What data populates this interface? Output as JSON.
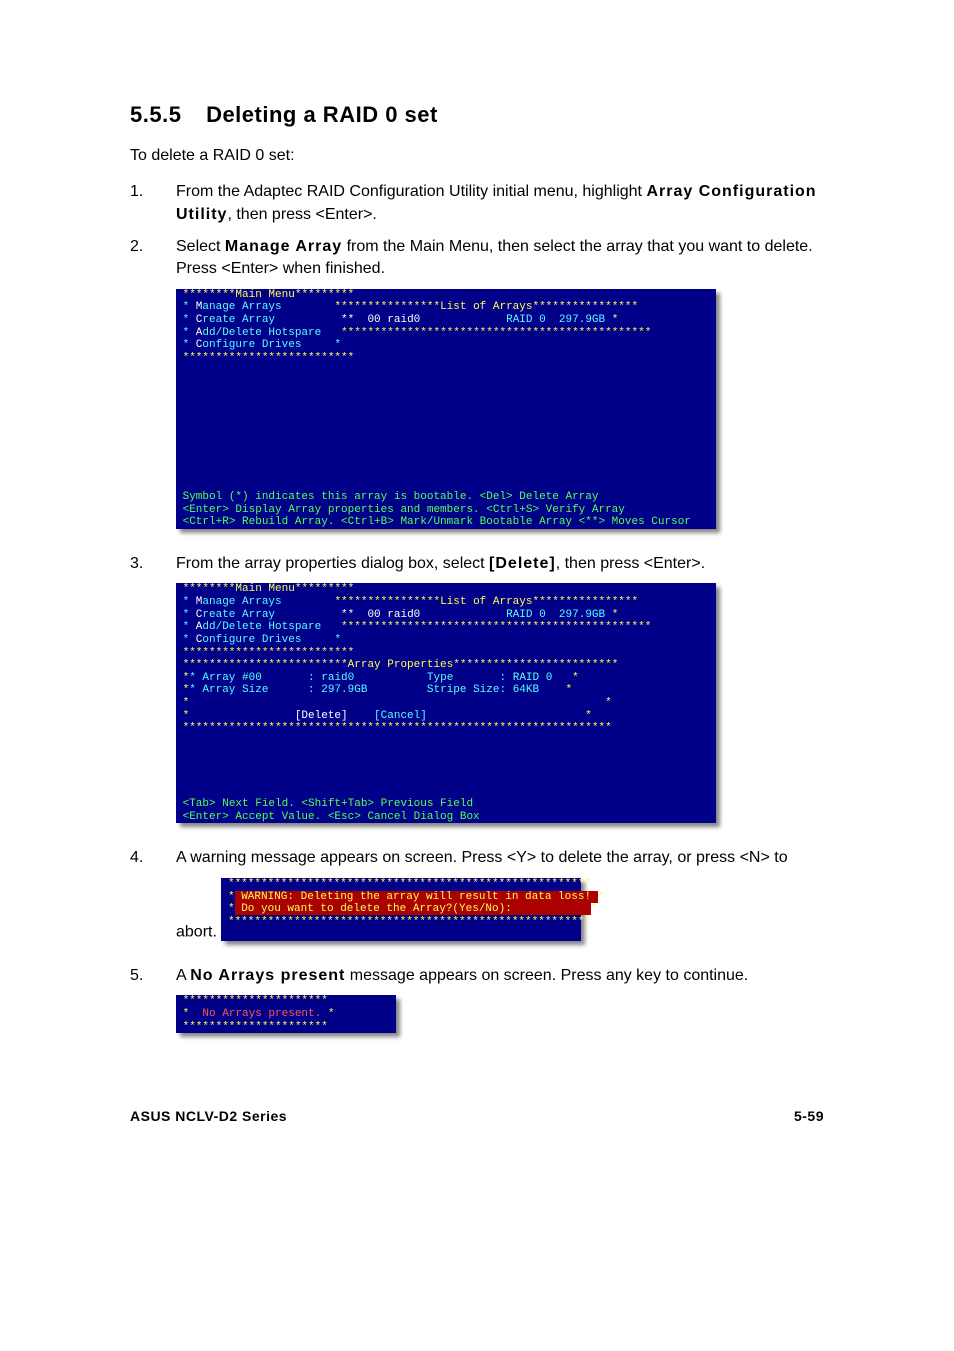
{
  "heading": {
    "number": "5.5.5",
    "title": "Deleting a RAID 0 set"
  },
  "intro": "To delete a RAID 0 set:",
  "steps": {
    "s1a": "From the Adaptec RAID Configuration Utility initial menu, highlight ",
    "s1b": "Array Configuration Utility",
    "s1c": ", then press <Enter>.",
    "s2a": "Select ",
    "s2b": "Manage Array",
    "s2c": " from the Main Menu, then select the array that you want to delete. Press <Enter> when finished.",
    "s3a": "From the array properties dialog box, select ",
    "s3b": "[Delete]",
    "s3c": ", then press <Enter>.",
    "s4": "A warning message appears on screen. Press <Y> to delete the array, or press <N> to abort.",
    "s5a": "A ",
    "s5b": "No Arrays present",
    "s5c": " message appears on screen. Press any key to continue."
  },
  "term1": {
    "main_menu_title": "Main Menu",
    "menu": {
      "m1": "anage Arrays",
      "m2": "reate Array",
      "m3": "dd/Delete Hotspare",
      "m4": "onfigure Drives"
    },
    "list_title": "List of Arrays",
    "list_row": {
      "id": "00",
      "name": "raid0",
      "level": "RAID 0",
      "size": "297.9GB"
    },
    "legend": {
      "l1": "Symbol (*) indicates this array is bootable. <Del> Delete Array",
      "l2": "<Enter> Display Array properties and members. <Ctrl+S> Verify Array",
      "l3": "<Ctrl+R> Rebuild Array. <Ctrl+B> Mark/Unmark Bootable Array <**> Moves Cursor"
    }
  },
  "term2": {
    "panel_title": "Array Properties",
    "props": {
      "p1l": "Array #00",
      "p1v": "raid0",
      "p2l": "Array Size",
      "p2v": "297.9GB",
      "p3l": "Type",
      "p3v": "RAID 0",
      "p4l": "Stripe Size:",
      "p4v": "64KB"
    },
    "buttons": {
      "del": "[Delete]",
      "cancel": "[Cancel]"
    },
    "legend": {
      "l1": "<Tab> Next Field. <Shift+Tab> Previous Field",
      "l2": "<Enter> Accept Value. <Esc> Cancel Dialog Box"
    }
  },
  "term3": {
    "w1": "WARNING: Deleting the array will result in data loss!",
    "w2": "Do you want to delete the Array?(Yes/No):"
  },
  "term4": {
    "msg": "No Arrays present."
  },
  "footer": {
    "left": "ASUS NCLV-D2 Series",
    "right": "5-59"
  }
}
